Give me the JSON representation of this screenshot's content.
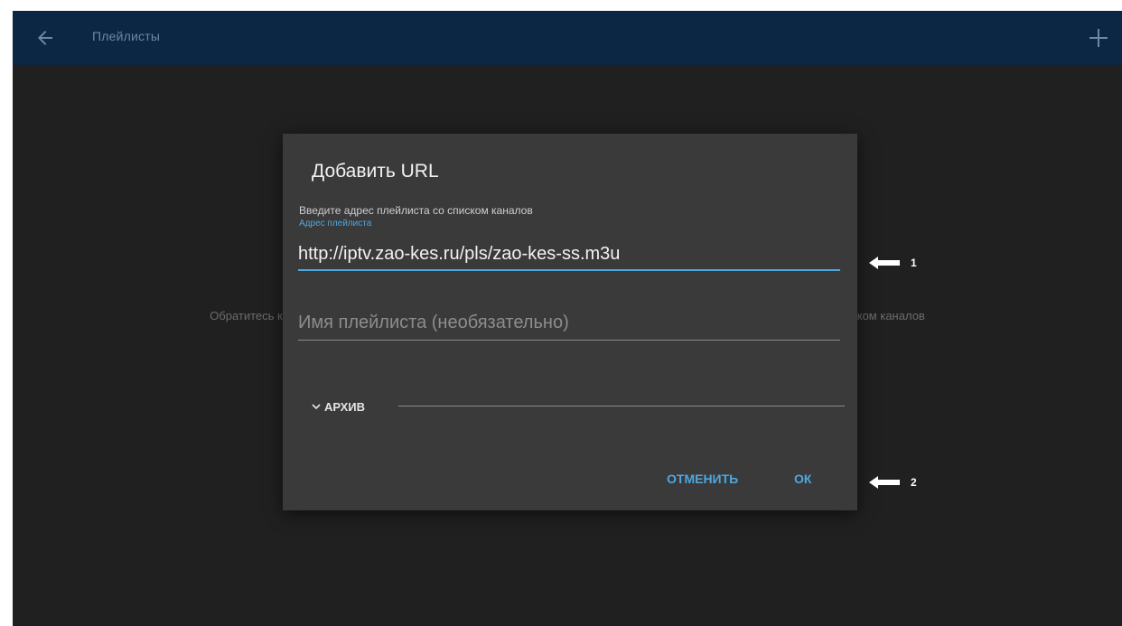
{
  "appbar": {
    "title": "Плейлисты",
    "back_icon": "arrow-left-icon",
    "add_icon": "plus-icon",
    "color": "#0b2743"
  },
  "background": {
    "hint_left": "Обратитесь к",
    "hint_right": "ком каналов",
    "color": "#202020"
  },
  "dialog": {
    "title": "Добавить URL",
    "subtitle": "Введите адрес плейлиста со списком каналов",
    "url_field": {
      "label": "Адрес плейлиста",
      "value": "http://iptv.zao-kes.ru/pls/zao-kes-ss.m3u"
    },
    "name_field": {
      "placeholder": "Имя плейлиста (необязательно)",
      "value": ""
    },
    "archive": {
      "label": "АРХИВ",
      "icon": "chevron-down-icon"
    },
    "buttons": {
      "cancel": "ОТМЕНИТЬ",
      "ok": "ОК"
    },
    "accent": "#4fa7df",
    "color": "#3a3a3a"
  },
  "annotations": [
    {
      "label": "1",
      "icon": "arrow-left-icon"
    },
    {
      "label": "2",
      "icon": "arrow-left-icon"
    }
  ]
}
